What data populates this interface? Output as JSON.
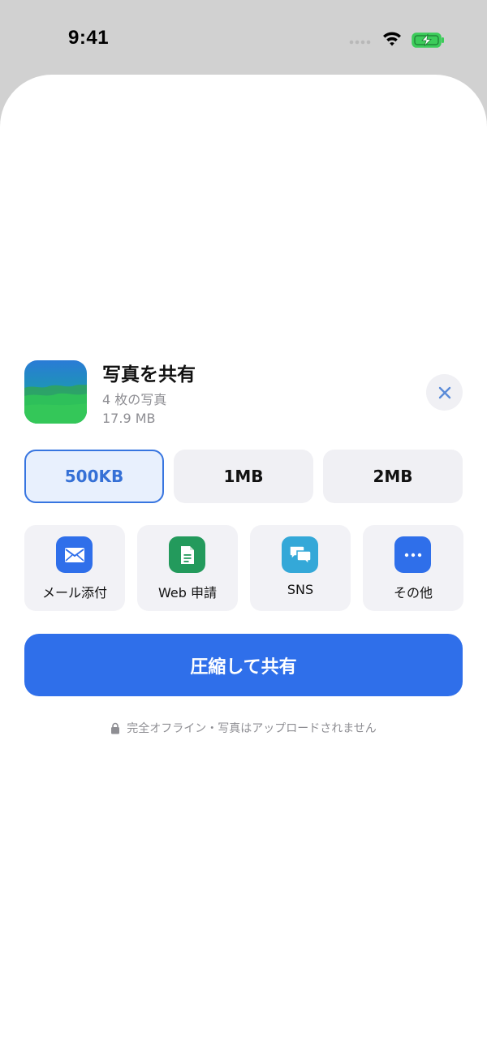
{
  "status_bar": {
    "time": "9:41"
  },
  "sheet": {
    "title": "写真を共有",
    "subtitle": "4 枚の写真",
    "total_size": "17.9 MB",
    "size_options": [
      {
        "label": "500KB",
        "selected": true
      },
      {
        "label": "1MB",
        "selected": false
      },
      {
        "label": "2MB",
        "selected": false
      }
    ],
    "share_targets": [
      {
        "label": "メール添付",
        "icon": "mail-icon",
        "color": "#2f6fea"
      },
      {
        "label": "Web 申請",
        "icon": "document-icon",
        "color": "#239a5c"
      },
      {
        "label": "SNS",
        "icon": "chat-bubbles-icon",
        "color": "#34a8d8"
      },
      {
        "label": "その他",
        "icon": "more-icon",
        "color": "#2f6fea"
      }
    ],
    "primary_action": "圧縮して共有",
    "footnote": "完全オフライン・写真はアップロードされません"
  },
  "colors": {
    "accent": "#2f6fea",
    "selected_bg": "#e8f0fd"
  }
}
